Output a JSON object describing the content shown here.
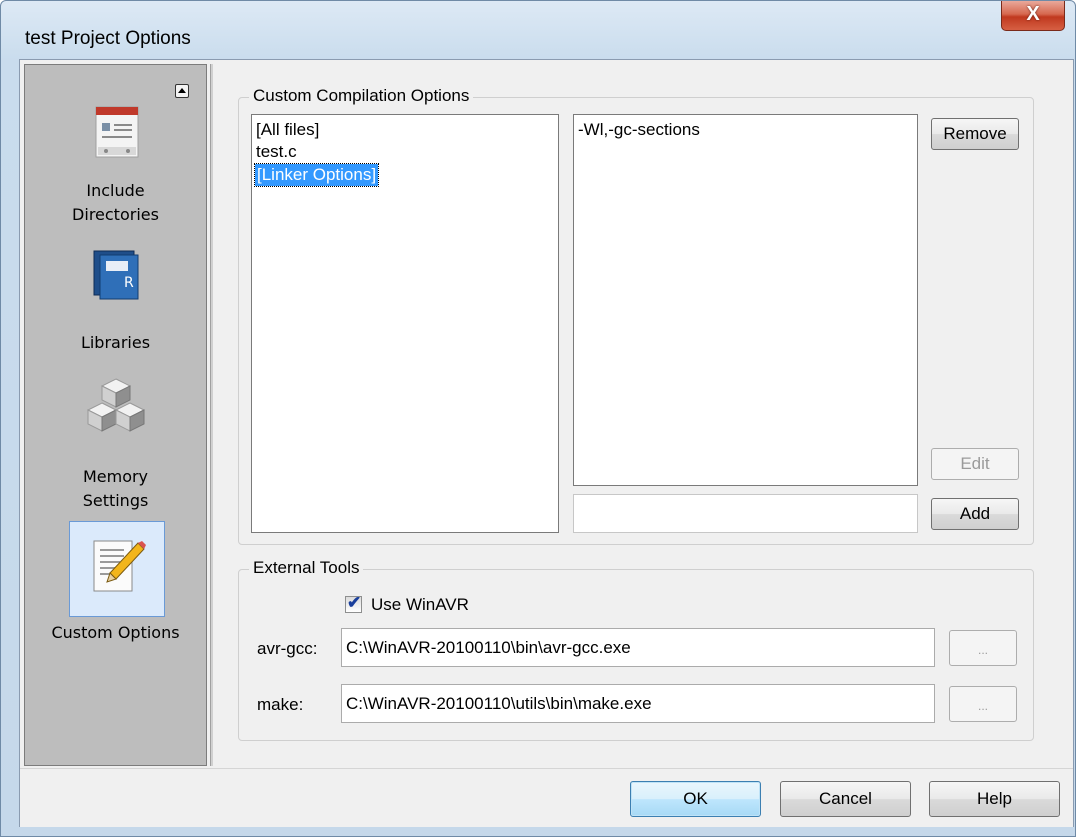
{
  "window": {
    "title": "test Project Options",
    "close_glyph": "X"
  },
  "sidebar": {
    "scroll_up_icon": "triangle-up-icon",
    "items": [
      {
        "label_line1": "Include",
        "label_line2": "Directories",
        "icon": "include-directories-icon"
      },
      {
        "label_line1": "Libraries",
        "label_line2": "",
        "icon": "libraries-book-icon"
      },
      {
        "label_line1": "Memory",
        "label_line2": "Settings",
        "icon": "memory-cubes-icon"
      },
      {
        "label_line1": "Custom Options",
        "label_line2": "",
        "icon": "notepad-pencil-icon",
        "selected": true
      }
    ]
  },
  "custom_compilation": {
    "legend": "Custom Compilation Options",
    "files": [
      "[All files]",
      "test.c",
      "[Linker Options]"
    ],
    "selected_file_index": 2,
    "options": [
      "-Wl,-gc-sections"
    ],
    "new_option_value": "",
    "remove_label": "Remove",
    "edit_label": "Edit",
    "add_label": "Add"
  },
  "external_tools": {
    "legend": "External Tools",
    "use_winavr_label": "Use WinAVR",
    "use_winavr_checked": true,
    "avr_gcc_label": "avr-gcc:",
    "avr_gcc_path": "C:\\WinAVR-20100110\\bin\\avr-gcc.exe",
    "make_label": "make:",
    "make_path": "C:\\WinAVR-20100110\\utils\\bin\\make.exe",
    "browse_label": "..."
  },
  "buttons": {
    "ok": "OK",
    "cancel": "Cancel",
    "help": "Help"
  }
}
